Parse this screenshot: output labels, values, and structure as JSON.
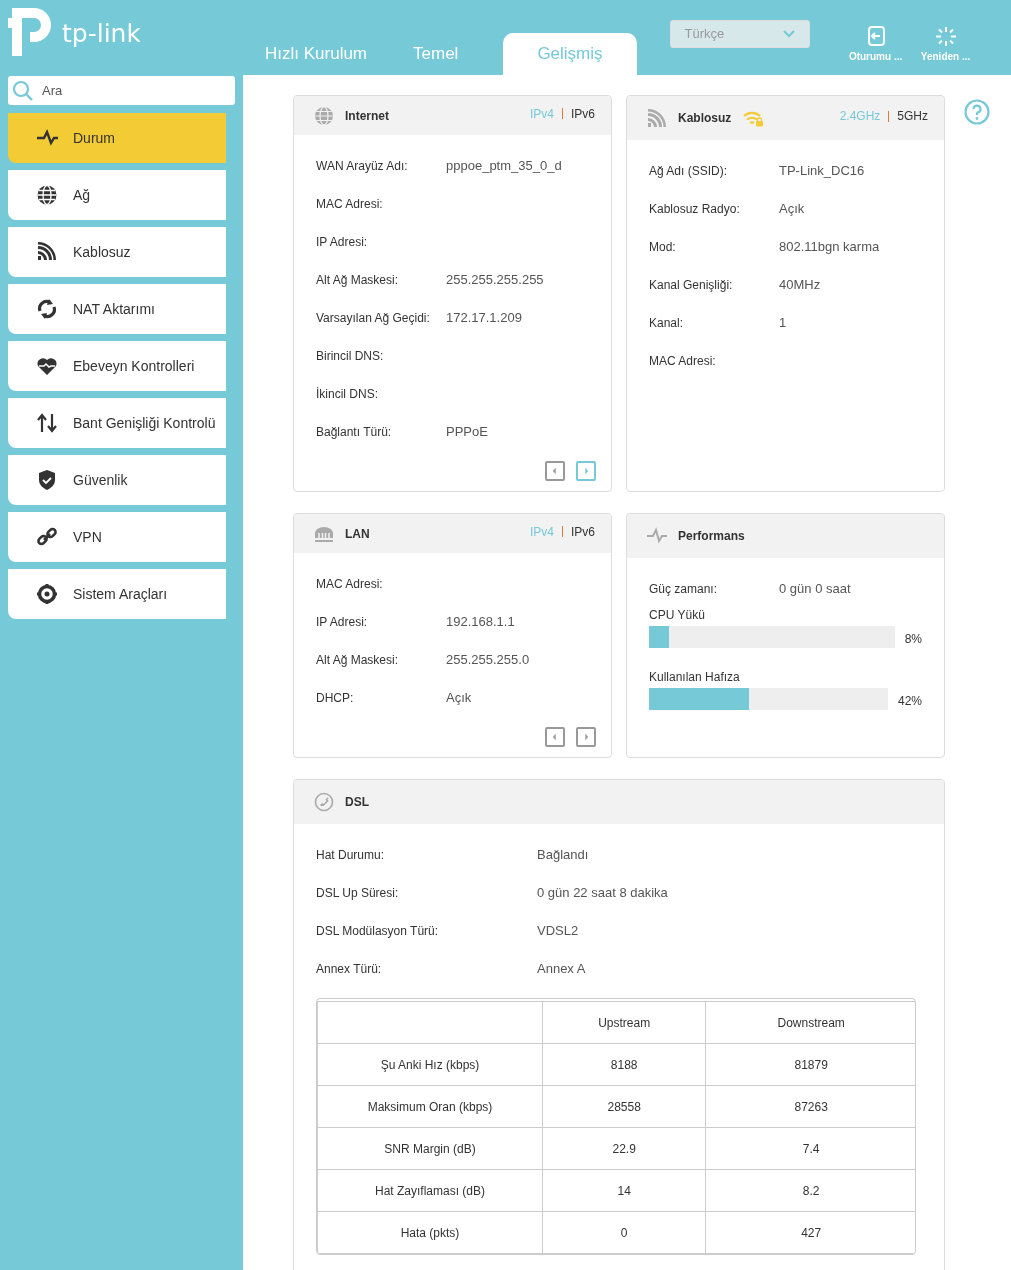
{
  "header": {
    "brand": "tp-link",
    "tabs": [
      {
        "label": "Hızlı Kurulum",
        "selected": false
      },
      {
        "label": "Temel",
        "selected": false
      },
      {
        "label": "Gelişmiş",
        "selected": true
      }
    ],
    "language": "Türkçe",
    "actions": [
      {
        "kind": "logout",
        "label": "Oturumu ..."
      },
      {
        "kind": "reboot",
        "label": "Yeniden ..."
      }
    ]
  },
  "sidebar": {
    "search": {
      "placeholder": "Ara"
    },
    "items": [
      {
        "kind": "status",
        "label": "Durum",
        "selected": true
      },
      {
        "kind": "network",
        "label": "Ağ",
        "selected": false
      },
      {
        "kind": "wireless",
        "label": "Kablosuz",
        "selected": false
      },
      {
        "kind": "nat",
        "label": "NAT Aktarımı",
        "selected": false
      },
      {
        "kind": "parental",
        "label": "Ebeveyn Kontrolleri",
        "selected": false
      },
      {
        "kind": "bandwidth",
        "label": "Bant Genişliği Kontrolü",
        "selected": false
      },
      {
        "kind": "security",
        "label": "Güvenlik",
        "selected": false
      },
      {
        "kind": "vpn",
        "label": "VPN",
        "selected": false
      },
      {
        "kind": "tools",
        "label": "Sistem Araçları",
        "selected": false
      }
    ]
  },
  "panels": [
    {
      "kind": "internet",
      "title": "Internet",
      "toggles": [
        {
          "label": "IPv4",
          "selected": true
        },
        {
          "label": "IPv6",
          "selected": false
        }
      ],
      "rows": [
        {
          "label": "WAN Arayüz Adı:",
          "value": "pppoe_ptm_35_0_d"
        },
        {
          "label": "MAC Adresi:"
        },
        {
          "label": "IP Adresi:"
        },
        {
          "label": "Alt Ağ Maskesi:",
          "value": "255.255.255.255"
        },
        {
          "label": "Varsayılan Ağ Geçidi:",
          "value": "172.17.1.209"
        },
        {
          "label": "Birincil DNS:"
        },
        {
          "label": "İkincil DNS:"
        },
        {
          "label": "Bağlantı Türü:",
          "value": "PPPoE"
        }
      ],
      "pager": {
        "prev_disabled": true,
        "next_disabled": false
      }
    },
    {
      "kind": "wireless",
      "title": "Kablosuz",
      "toggles": [
        {
          "label": "2.4GHz",
          "selected": true
        },
        {
          "label": "5GHz",
          "selected": false
        }
      ],
      "rows": [
        {
          "label": "Ağ Adı (SSID):",
          "value": "TP-Link_DC16"
        },
        {
          "label": "Kablosuz Radyo:",
          "value": "Açık"
        },
        {
          "label": "Mod:",
          "value": "802.11bgn karma"
        },
        {
          "label": "Kanal Genişliği:",
          "value": "40MHz"
        },
        {
          "label": "Kanal:",
          "value": "1"
        },
        {
          "label": "MAC Adresi:"
        }
      ]
    },
    {
      "kind": "lan",
      "title": "LAN",
      "toggles": [
        {
          "label": "IPv4",
          "selected": true
        },
        {
          "label": "IPv6",
          "selected": false
        }
      ],
      "rows": [
        {
          "label": "MAC Adresi:"
        },
        {
          "label": "IP Adresi:",
          "value": "192.168.1.1"
        },
        {
          "label": "Alt Ağ Maskesi:",
          "value": "255.255.255.0"
        },
        {
          "label": "DHCP:",
          "value": "Açık"
        }
      ],
      "pager": {
        "prev_disabled": true,
        "next_disabled": true
      }
    },
    {
      "kind": "performance",
      "title": "Performans",
      "uptime": {
        "label": "Güç zamanı:",
        "value": "0 gün 0 saat"
      },
      "meters": [
        {
          "label": "CPU Yükü",
          "level": 0.08,
          "reading": "8%"
        },
        {
          "label": "Kullanılan Hafıza",
          "level": 0.42,
          "reading": "42%"
        }
      ]
    }
  ],
  "dsl": {
    "title": "DSL",
    "rows": [
      {
        "label": "Hat Durumu:",
        "value": "Bağlandı"
      },
      {
        "label": "DSL Up Süresi:",
        "value": "0 gün 22 saat 8 dakika"
      },
      {
        "label": "DSL Modülasyon Türü:",
        "value": "VDSL2"
      },
      {
        "label": "Annex Türü:",
        "value": "Annex A"
      }
    ],
    "table": {
      "columns": [
        "Upstream",
        "Downstream"
      ],
      "rows": [
        {
          "label": "Şu Anki Hız (kbps)",
          "values": [
            "8188",
            "81879"
          ]
        },
        {
          "label": "Maksimum Oran (kbps)",
          "values": [
            "28558",
            "87263"
          ]
        },
        {
          "label": "SNR Margin (dB)",
          "values": [
            "22.9",
            "7.4"
          ]
        },
        {
          "label": "Hat Zayıflaması (dB)",
          "values": [
            "14",
            "8.2"
          ]
        },
        {
          "label": "Hata (pkts)",
          "values": [
            "0",
            "427"
          ]
        }
      ]
    }
  }
}
